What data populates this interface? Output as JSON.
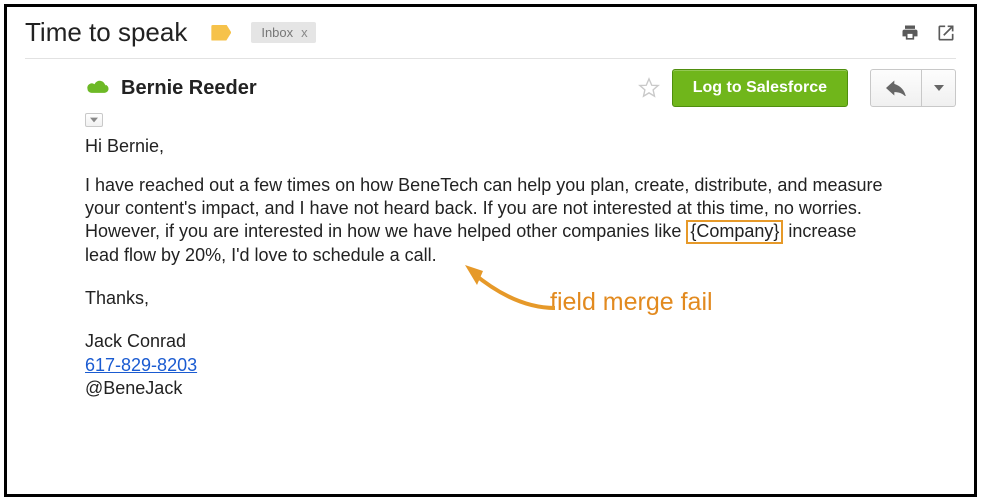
{
  "header": {
    "subject": "Time to speak",
    "inbox_label": "Inbox",
    "inbox_close": "x"
  },
  "sender": {
    "name": "Bernie Reeder"
  },
  "actions": {
    "salesforce": "Log to Salesforce"
  },
  "body": {
    "greeting": "Hi Bernie,",
    "para_before_token": "I have reached out a few times on how BeneTech can help you plan, create, distribute, and measure your content's impact, and I have not heard back. If you are not interested at this time, no worries. However, if you are interested in how we have helped other companies like ",
    "merge_token": "{Company}",
    "para_after_token": " increase lead flow by 20%, I'd love to schedule a call.",
    "thanks": "Thanks,",
    "sig_name": "Jack Conrad",
    "sig_phone": "617-829-8203",
    "sig_handle": "@BeneJack"
  },
  "annotation": {
    "text": "field merge fail"
  }
}
